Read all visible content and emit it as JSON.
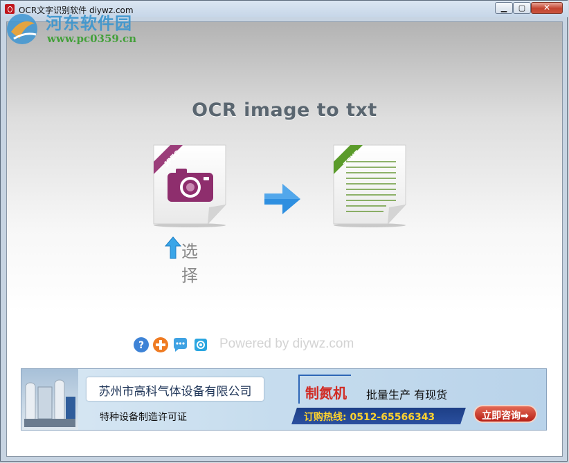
{
  "window": {
    "title": "OCR文字识别软件 diywz.com",
    "controls": {
      "minimize": "▁",
      "maximize": "▢",
      "close": "✕"
    }
  },
  "watermark": {
    "name": "河东软件园",
    "url": "www.pc0359.cn"
  },
  "main": {
    "heading": "OCR image to txt",
    "source_badge": "JPEG",
    "target_badge": "TEXT",
    "select_label": "选择",
    "powered_by": "Powered by diywz.com"
  },
  "footer_icons": [
    "help-icon",
    "add-icon",
    "chat-icon",
    "qq-icon"
  ],
  "banner": {
    "company": "苏州市高科气体设备有限公司",
    "license": "特种设备制造许可证",
    "product": "制氮机",
    "slogan": "批量生产 有现货",
    "hotline": "订购热线: 0512-65566343",
    "consult": "立即咨询➡"
  },
  "colors": {
    "heading": "#5a6670",
    "jpeg_badge": "#9b3d7a",
    "camera": "#8e2e6d",
    "text_badge": "#5a9b2a",
    "arrow": "#2e8fe0",
    "banner_red": "#d12b24"
  }
}
